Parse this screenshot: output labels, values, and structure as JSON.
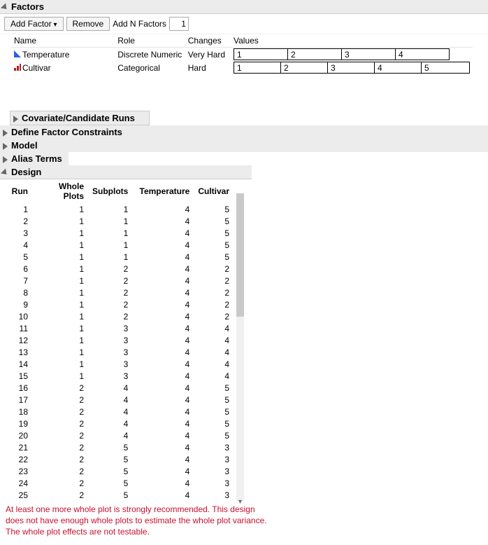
{
  "panels": {
    "factors": "Factors",
    "covariate": "Covariate/Candidate Runs",
    "constraints": "Define Factor Constraints",
    "model": "Model",
    "alias": "Alias Terms",
    "design": "Design"
  },
  "toolbar": {
    "add_factor": "Add Factor",
    "remove": "Remove",
    "add_n": "Add N Factors",
    "n_value": "1"
  },
  "factors_headers": {
    "name": "Name",
    "role": "Role",
    "changes": "Changes",
    "values": "Values"
  },
  "factors": [
    {
      "icon": "tri",
      "name": "Temperature",
      "role": "Discrete Numeric",
      "changes": "Very Hard",
      "values": [
        "1",
        "2",
        "3",
        "4"
      ]
    },
    {
      "icon": "bars",
      "name": "Cultivar",
      "role": "Categorical",
      "changes": "Hard",
      "values": [
        "1",
        "2",
        "3",
        "4",
        "5"
      ]
    }
  ],
  "design_headers": {
    "run": "Run",
    "whole": "Whole Plots",
    "sub": "Subplots",
    "temp": "Temperature",
    "cult": "Cultivar"
  },
  "design_rows": [
    {
      "run": 1,
      "whole": 1,
      "sub": 1,
      "temp": 4,
      "cult": 5
    },
    {
      "run": 2,
      "whole": 1,
      "sub": 1,
      "temp": 4,
      "cult": 5
    },
    {
      "run": 3,
      "whole": 1,
      "sub": 1,
      "temp": 4,
      "cult": 5
    },
    {
      "run": 4,
      "whole": 1,
      "sub": 1,
      "temp": 4,
      "cult": 5
    },
    {
      "run": 5,
      "whole": 1,
      "sub": 1,
      "temp": 4,
      "cult": 5
    },
    {
      "run": 6,
      "whole": 1,
      "sub": 2,
      "temp": 4,
      "cult": 2
    },
    {
      "run": 7,
      "whole": 1,
      "sub": 2,
      "temp": 4,
      "cult": 2
    },
    {
      "run": 8,
      "whole": 1,
      "sub": 2,
      "temp": 4,
      "cult": 2
    },
    {
      "run": 9,
      "whole": 1,
      "sub": 2,
      "temp": 4,
      "cult": 2
    },
    {
      "run": 10,
      "whole": 1,
      "sub": 2,
      "temp": 4,
      "cult": 2
    },
    {
      "run": 11,
      "whole": 1,
      "sub": 3,
      "temp": 4,
      "cult": 4
    },
    {
      "run": 12,
      "whole": 1,
      "sub": 3,
      "temp": 4,
      "cult": 4
    },
    {
      "run": 13,
      "whole": 1,
      "sub": 3,
      "temp": 4,
      "cult": 4
    },
    {
      "run": 14,
      "whole": 1,
      "sub": 3,
      "temp": 4,
      "cult": 4
    },
    {
      "run": 15,
      "whole": 1,
      "sub": 3,
      "temp": 4,
      "cult": 4
    },
    {
      "run": 16,
      "whole": 2,
      "sub": 4,
      "temp": 4,
      "cult": 5
    },
    {
      "run": 17,
      "whole": 2,
      "sub": 4,
      "temp": 4,
      "cult": 5
    },
    {
      "run": 18,
      "whole": 2,
      "sub": 4,
      "temp": 4,
      "cult": 5
    },
    {
      "run": 19,
      "whole": 2,
      "sub": 4,
      "temp": 4,
      "cult": 5
    },
    {
      "run": 20,
      "whole": 2,
      "sub": 4,
      "temp": 4,
      "cult": 5
    },
    {
      "run": 21,
      "whole": 2,
      "sub": 5,
      "temp": 4,
      "cult": 3
    },
    {
      "run": 22,
      "whole": 2,
      "sub": 5,
      "temp": 4,
      "cult": 3
    },
    {
      "run": 23,
      "whole": 2,
      "sub": 5,
      "temp": 4,
      "cult": 3
    },
    {
      "run": 24,
      "whole": 2,
      "sub": 5,
      "temp": 4,
      "cult": 3
    },
    {
      "run": 25,
      "whole": 2,
      "sub": 5,
      "temp": 4,
      "cult": 3
    }
  ],
  "warning_text": "At least one more whole plot is strongly recommended. This design does not have enough whole plots to estimate the whole plot variance. The whole plot effects are not testable.",
  "value_widths_4": [
    78,
    78,
    78,
    78
  ],
  "value_widths_5": [
    68,
    68,
    68,
    68,
    70
  ]
}
